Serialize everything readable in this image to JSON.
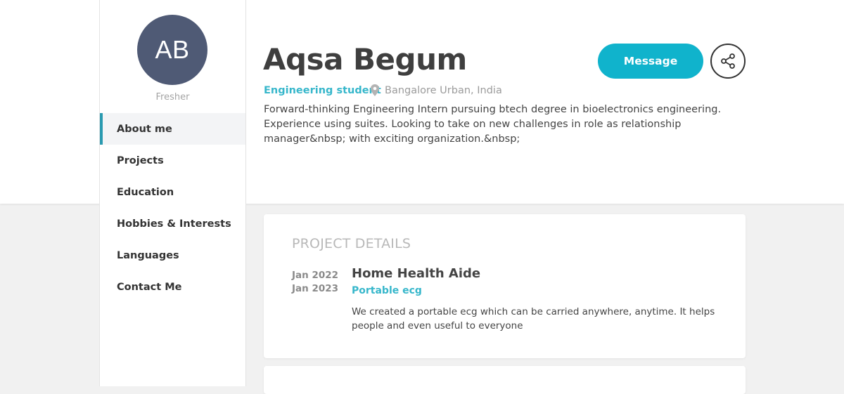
{
  "profile": {
    "initials": "AB",
    "status": "Fresher",
    "name": "Aqsa Begum",
    "role": "Engineering student",
    "location": "Bangalore Urban, India",
    "bio": "Forward-thinking Engineering Intern pursuing btech degree in bioelectronics engineering. Experience using suites. Looking to take on new challenges in role as relationship manager&nbsp; with exciting organization.&nbsp;",
    "avatar_color": "#4f5a75"
  },
  "actions": {
    "message_label": "Message",
    "share_icon": "share-icon"
  },
  "nav": {
    "items": [
      {
        "label": "About me",
        "active": true
      },
      {
        "label": "Projects"
      },
      {
        "label": "Education"
      },
      {
        "label": "Hobbies & Interests"
      },
      {
        "label": "Languages"
      },
      {
        "label": "Contact Me"
      }
    ]
  },
  "projects": {
    "section_title": "PROJECT DETAILS",
    "items": [
      {
        "start": "Jan 2022",
        "end": "Jan 2023",
        "title": "Home Health Aide",
        "subtitle": "Portable ecg",
        "description": "We created a portable ecg which can be carried anywhere, anytime. It helps people and even useful to everyone"
      }
    ]
  },
  "colors": {
    "accent": "#10b3cc",
    "accent_text": "#37b7cb",
    "nav_active_border": "#2a9ab0"
  }
}
